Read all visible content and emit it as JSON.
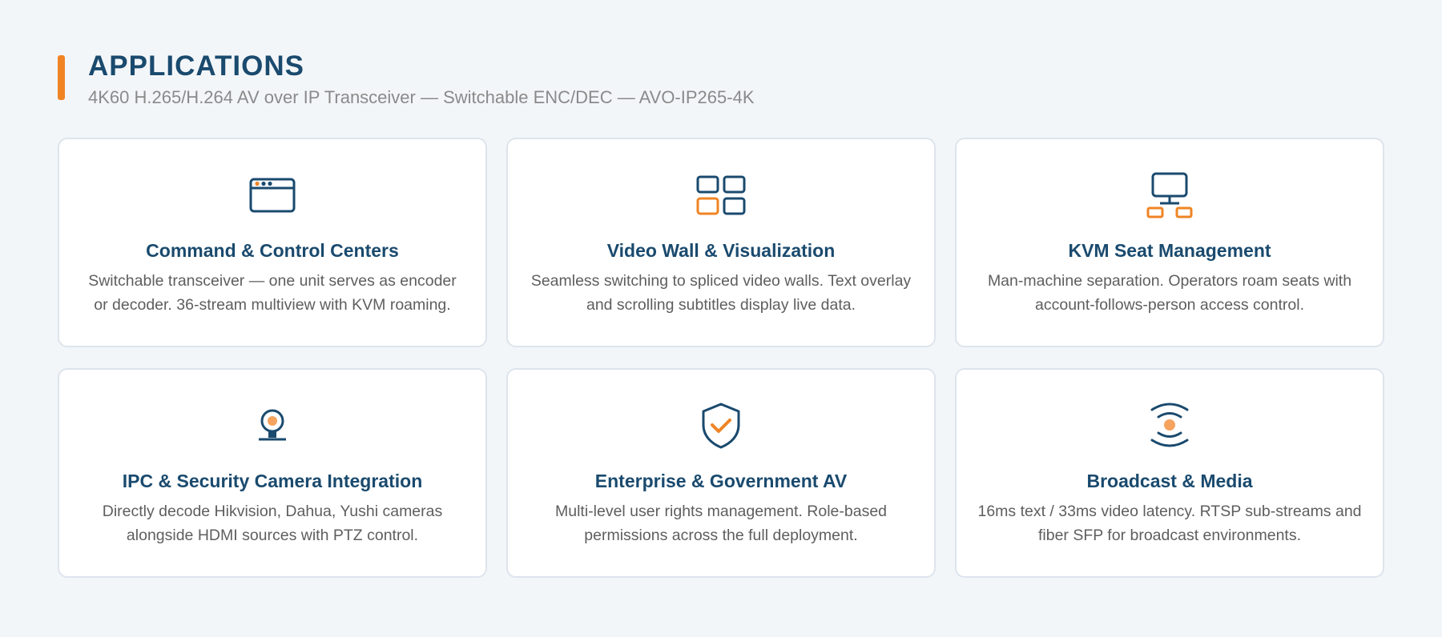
{
  "header": {
    "title": "APPLICATIONS",
    "subtitle": "4K60 H.265/H.264 AV over IP Transceiver — Switchable ENC/DEC — AVO-IP265-4K"
  },
  "colors": {
    "primary": "#1a4a6e",
    "accent": "#f08424",
    "background": "#f3f6f9"
  },
  "cards": [
    {
      "icon": "browser-window-icon",
      "title": "Command & Control Centers",
      "description": "Switchable transceiver — one unit serves as encoder or decoder. 36-stream multiview with KVM roaming."
    },
    {
      "icon": "grid-tiles-icon",
      "title": "Video Wall & Visualization",
      "description": "Seamless switching to spliced video walls. Text overlay and scrolling subtitles display live data."
    },
    {
      "icon": "network-monitor-icon",
      "title": "KVM Seat Management",
      "description": "Man-machine separation. Operators roam seats with account-follows-person access control."
    },
    {
      "icon": "webcam-icon",
      "title": "IPC & Security Camera Integration",
      "description": "Directly decode Hikvision, Dahua, Yushi cameras alongside HDMI sources with PTZ control."
    },
    {
      "icon": "shield-check-icon",
      "title": "Enterprise & Government AV",
      "description": "Multi-level user rights management. Role-based permissions across the full deployment."
    },
    {
      "icon": "broadcast-signal-icon",
      "title": "Broadcast & Media",
      "description": "16ms text / 33ms video latency. RTSP sub-streams and fiber SFP for broadcast environments."
    }
  ]
}
